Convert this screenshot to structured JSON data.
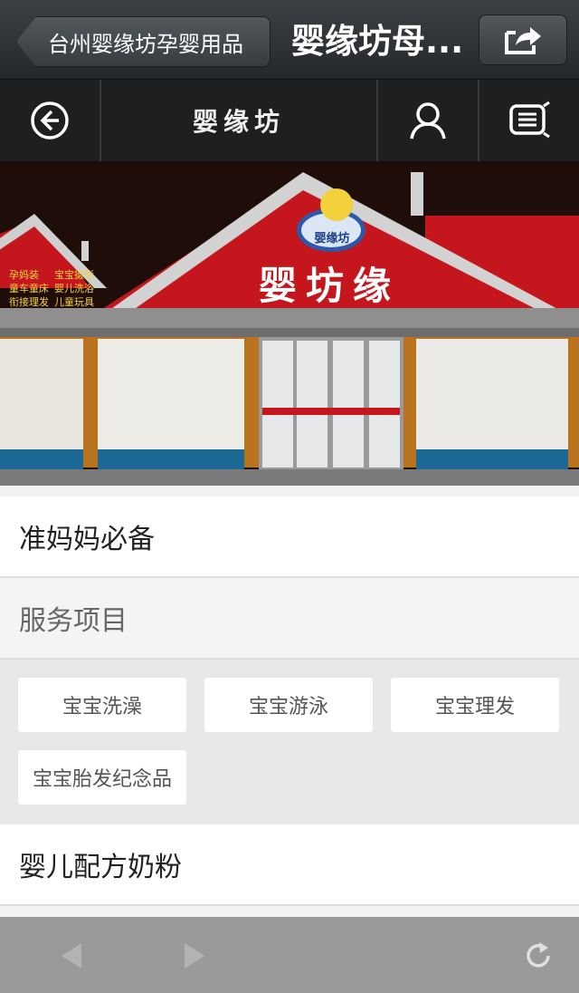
{
  "titlebar": {
    "back_label": "台州婴缘坊孕婴用品",
    "title": "婴缘坊母..."
  },
  "nav": {
    "brand": "婴缘坊"
  },
  "banner": {
    "store_sign": "婴坊缘",
    "logo_text": "婴缘坊",
    "services_left": [
      "孕妈装",
      "童车童床",
      "衔接理发"
    ],
    "services_right": [
      "宝宝摄影",
      "婴儿洗浴",
      "儿童玩具"
    ]
  },
  "sections": [
    {
      "label": "准妈妈必备"
    },
    {
      "label": "服务项目"
    },
    {
      "label": "婴儿配方奶粉"
    }
  ],
  "service_tags": [
    {
      "label": "宝宝洗澡"
    },
    {
      "label": "宝宝游泳"
    },
    {
      "label": "宝宝理发"
    },
    {
      "label": "宝宝胎发纪念品"
    }
  ],
  "colors": {
    "sign_red": "#c4161c",
    "toolbar_gray": "#9a9a9a",
    "nav_dark": "#1e1f20"
  }
}
